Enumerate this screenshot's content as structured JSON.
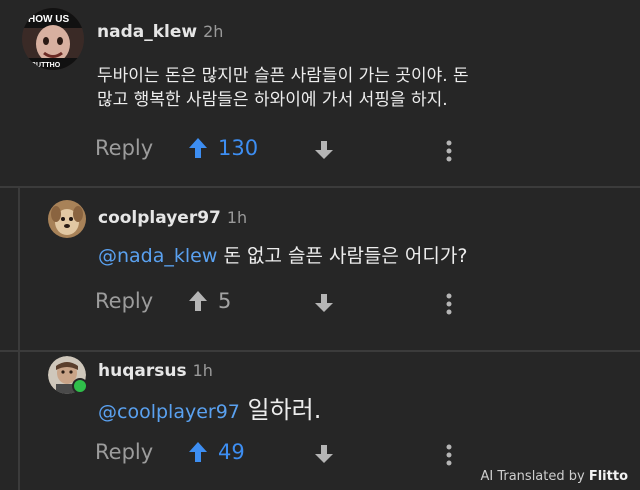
{
  "comments": [
    {
      "username": "nada_klew",
      "time": "2h",
      "avatar_text_top": "HOW US",
      "avatar_text_bottom": "BUTTHO",
      "lines": [
        "두바이는 돈은 많지만 슬픈 사람들이 가는 곳이야. 돈",
        "많고 행복한 사람들은 하와이에 가서 서핑을 하지."
      ],
      "reply_label": "Reply",
      "score": "130",
      "upvoted": true
    },
    {
      "username": "coolplayer97",
      "time": "1h",
      "mention": "@nada_klew",
      "text": " 돈 없고 슬픈 사람들은 어디가?",
      "reply_label": "Reply",
      "score": "5",
      "upvoted": false
    },
    {
      "username": "huqarsus",
      "time": "1h",
      "mention": "@coolplayer97",
      "text": " 일하러.",
      "reply_label": "Reply",
      "score": "49",
      "upvoted": true
    }
  ],
  "attribution": {
    "prefix": "AI Translated by ",
    "brand": "Flitto"
  },
  "colors": {
    "upvote": "#3d8ef2",
    "mention": "#5aa1f0",
    "background": "#262626"
  },
  "icons": [
    "arrow-up-icon",
    "arrow-down-icon",
    "more-vertical-icon"
  ]
}
